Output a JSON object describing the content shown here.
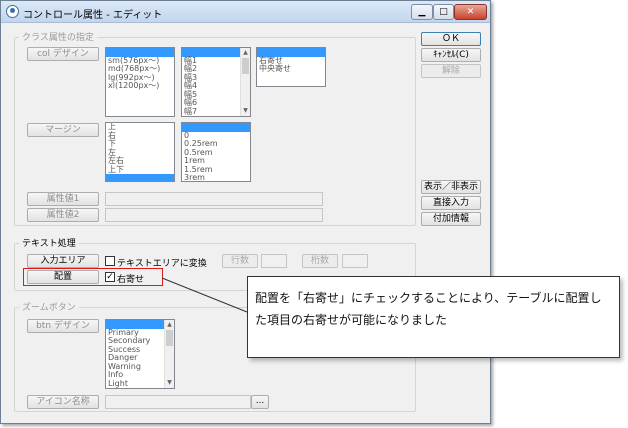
{
  "window": {
    "title": "コントロール属性 - エディット"
  },
  "controls": {
    "min_icon": "minimize-icon",
    "max_icon": "maximize-icon",
    "close_icon": "close-icon"
  },
  "class_section": {
    "legend": "クラス属性の指定",
    "col_button": "col デザイン",
    "col_list": [
      "sm(576px〜)",
      "md(768px〜)",
      "lg(992px〜)",
      "xl(1200px〜)"
    ],
    "width_list": [
      "幅1",
      "幅2",
      "幅3",
      "幅4",
      "幅5",
      "幅6",
      "幅7"
    ],
    "align_list": [
      "右寄せ",
      "中央寄せ"
    ],
    "margin_button": "マージン",
    "margin_list": [
      "上",
      "右",
      "下",
      "左",
      "左右",
      "上下"
    ],
    "rem_list": [
      "0",
      "0.25rem",
      "0.5rem",
      "1rem",
      "1.5rem",
      "3rem"
    ],
    "attr1_button": "属性値1",
    "attr2_button": "属性値2"
  },
  "text_section": {
    "legend": "テキスト処理",
    "input_area_button": "入力エリア",
    "textarea_checkbox_label": "テキストエリアに変換",
    "rows_button": "行数",
    "digits_button": "桁数",
    "placement_button": "配置",
    "align_right_label": "右寄せ",
    "align_right_checked": true
  },
  "zoom_section": {
    "legend": "ズームボタン",
    "btn_design_button": "btn デザイン",
    "btn_list": [
      "Primary",
      "Secondary",
      "Success",
      "Danger",
      "Warning",
      "Info",
      "Light"
    ],
    "icon_name_button": "アイコン名称",
    "browse_button": "..."
  },
  "side_buttons": {
    "ok": "ＯＫ",
    "cancel": "ｷｬﾝｾﾙ(C)",
    "release": "解除",
    "show_hide": "表示／非表示",
    "direct_input": "直接入力",
    "extra_info": "付加情報"
  },
  "callout": {
    "text": "配置を「右寄せ」にチェックすることにより、テーブルに配置した項目の右寄せが可能になりました"
  }
}
